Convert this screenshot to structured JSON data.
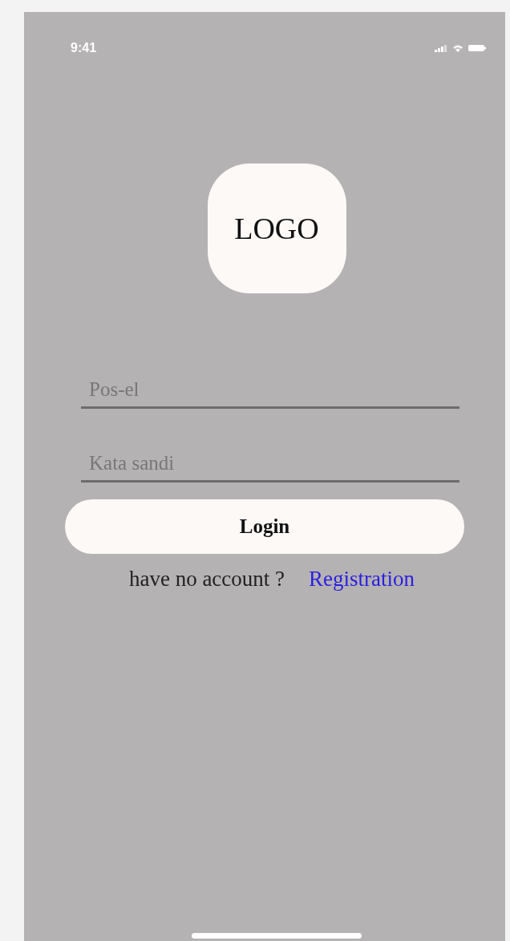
{
  "status_bar": {
    "time": "9:41"
  },
  "logo": {
    "text": "LOGO"
  },
  "fields": [
    {
      "placeholder": "Pos-el"
    },
    {
      "placeholder": "Kata sandi"
    }
  ],
  "login_button": {
    "label": "Login"
  },
  "register_prompt": {
    "text": "have no account ?",
    "link": "Registration"
  }
}
